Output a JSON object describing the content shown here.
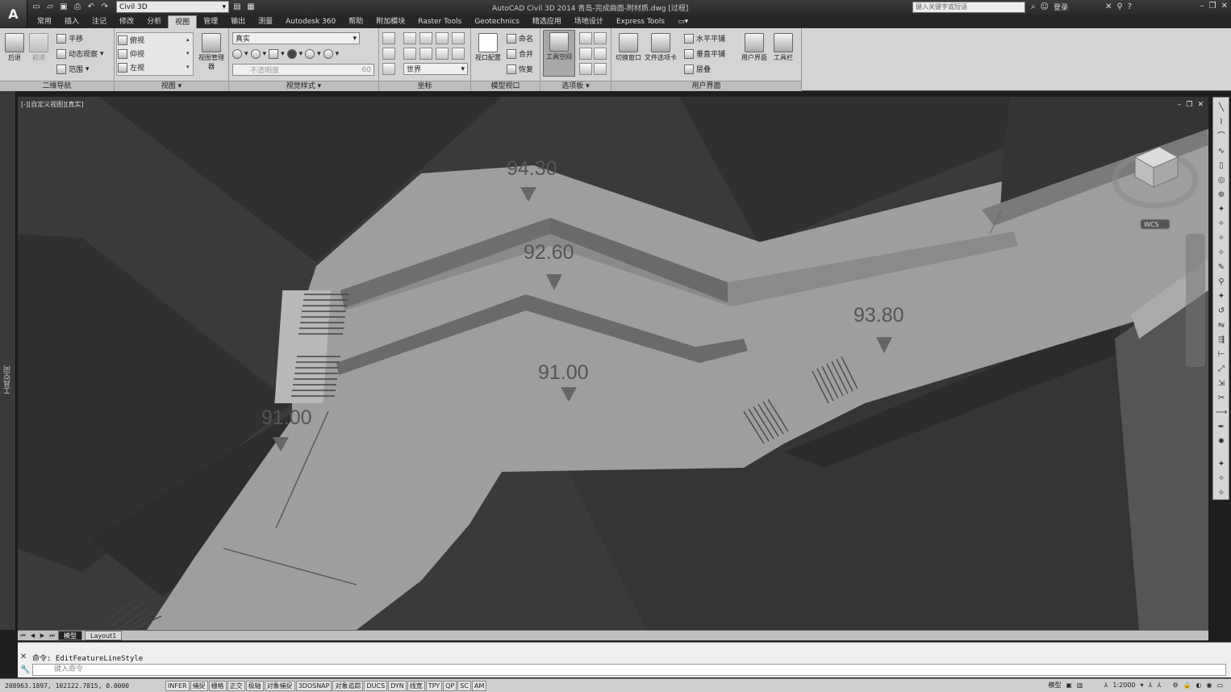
{
  "app": {
    "logo": "A",
    "workspace": "Civil 3D",
    "title": "AutoCAD Civil 3D 2014    青岛-完成曲面-附材质.dwg [过程]",
    "search_placeholder": "键入关键字或短语",
    "login": "登录"
  },
  "tabs": [
    "常用",
    "插入",
    "注记",
    "修改",
    "分析",
    "视图",
    "管理",
    "输出",
    "测量",
    "Autodesk 360",
    "帮助",
    "附加模块",
    "Raster Tools",
    "Geotechnics",
    "精选应用",
    "场地设计",
    "Express Tools"
  ],
  "active_tab": "视图",
  "ribbon": {
    "nav2d": {
      "label": "二维导航",
      "back": "后退",
      "forward": "前进",
      "pan": "平移",
      "orbit": "动态观察",
      "extents": "范围"
    },
    "views": {
      "label": "视图",
      "top": "俯视",
      "bottom": "仰视",
      "left": "左视",
      "manager": "视图管理器"
    },
    "visual_styles": {
      "label": "视觉样式",
      "current": "真实",
      "opacity_value": "60",
      "disabled_text": "不透明度"
    },
    "coords": {
      "label": "坐标",
      "world": "世界"
    },
    "model_viewports": {
      "label": "模型视口",
      "config": "视口配置",
      "named": "命名",
      "join": "合并",
      "restore": "恢复"
    },
    "palettes": {
      "label": "选项板",
      "tool_space": "工具空间"
    },
    "ui": {
      "label": "用户界面",
      "switch_window": "切换窗口",
      "file_tabs": "文件选项卡",
      "tile_h": "水平平铺",
      "tile_v": "垂直平铺",
      "cascade": "层叠",
      "user_interface": "用户界面",
      "toolbars": "工具栏"
    }
  },
  "viewport": {
    "label": "[-][自定义视图][真实]",
    "wcs": "WCS",
    "elevations": [
      {
        "text": "94.30"
      },
      {
        "text": "92.60"
      },
      {
        "text": "93.80"
      },
      {
        "text": "91.00"
      },
      {
        "text": "91.00"
      }
    ]
  },
  "left_palette_label": "工具空间",
  "layout_tabs": [
    "模型",
    "Layout1"
  ],
  "active_layout": "模型",
  "command": {
    "history": "命令: EditFeatureLineStyle",
    "placeholder": "键入命令"
  },
  "status": {
    "coords": "208963.1897, 102122.7815, 0.0000",
    "toggles": [
      "INFER",
      "捕捉",
      "栅格",
      "正交",
      "极轴",
      "对象捕捉",
      "3DOSNAP",
      "对象追踪",
      "DUCS",
      "DYN",
      "线宽",
      "TPY",
      "QP",
      "SC",
      "AM"
    ],
    "model": "模型",
    "scale": "1:2000"
  }
}
